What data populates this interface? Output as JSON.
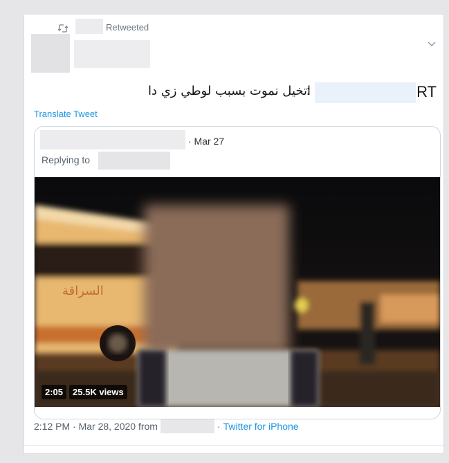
{
  "retweet": {
    "label": "Retweeted"
  },
  "tweet": {
    "rt_prefix": "RT",
    "separator": " :",
    "text": "اتخيل نموت بسبب لوطي زي دا",
    "translate_label": "Translate Tweet"
  },
  "quote": {
    "date": "· Mar 27",
    "replying_to": "Replying to"
  },
  "video": {
    "duration": "2:05",
    "views": "25.5K views"
  },
  "footer": {
    "time_date": "2:12 PM · Mar 28, 2020 from",
    "source_sep": "·",
    "source": "Twitter for iPhone"
  },
  "colors": {
    "link": "#1b95e0",
    "text": "#14171a",
    "muted": "#546270"
  },
  "icons": [
    "retweet-icon",
    "chevron-down-icon"
  ]
}
